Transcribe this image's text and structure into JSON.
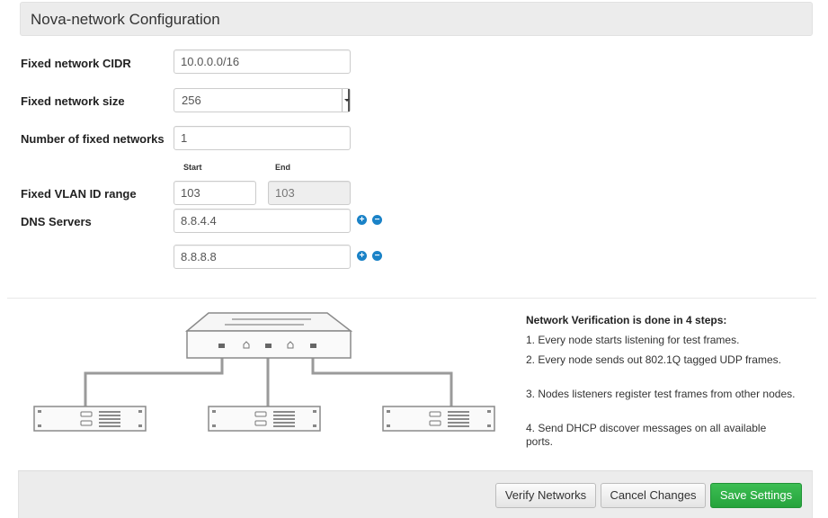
{
  "header": {
    "title": "Nova-network Configuration"
  },
  "form": {
    "fixed_cidr": {
      "label": "Fixed network CIDR",
      "value": "10.0.0.0/16"
    },
    "fixed_size": {
      "label": "Fixed network size",
      "value": "256"
    },
    "fixed_count": {
      "label": "Number of fixed networks",
      "value": "1"
    },
    "vlan": {
      "label": "Fixed VLAN ID range",
      "start_label": "Start",
      "end_label": "End",
      "start": "103",
      "end": "103"
    },
    "dns": {
      "label": "DNS Servers",
      "servers": [
        "8.8.4.4",
        "8.8.8.8"
      ]
    }
  },
  "icons": {
    "add": "plus-icon",
    "remove": "minus-icon"
  },
  "colors": {
    "icon_blue": "#1a82c7",
    "save_green": "#2db24a"
  },
  "verification": {
    "title": "Network Verification is done in 4 steps:",
    "steps": [
      "1. Every node starts listening for test frames.",
      "2. Every node sends out 802.1Q tagged UDP frames.",
      "3. Nodes listeners register test frames from other nodes.",
      "4. Send DHCP discover messages on all available ports."
    ]
  },
  "footer": {
    "verify_label": "Verify Networks",
    "cancel_label": "Cancel Changes",
    "save_label": "Save Settings"
  }
}
